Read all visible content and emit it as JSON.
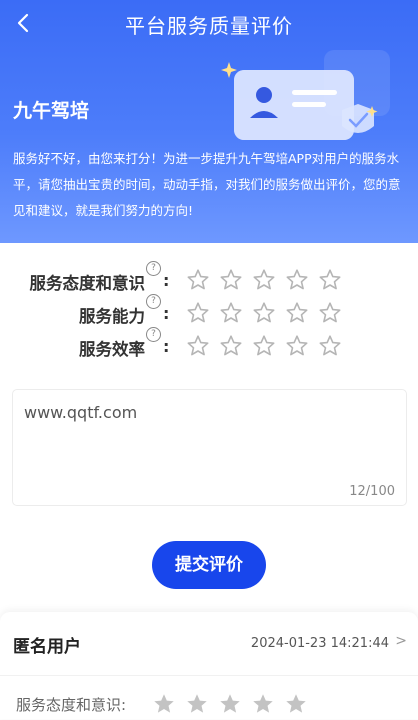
{
  "header": {
    "back_icon": "chevron-left-icon",
    "title": "平台服务质量评价"
  },
  "hero": {
    "brand": "九午驾培",
    "intro": "服务好不好，由您来打分！为进一步提升九午驾培APP对用户的服务水平，请您抽出宝贵的时间，动动手指，对我们的服务做出评价，您的意见和建议，就是我们努力的方向!"
  },
  "rating": {
    "items": [
      {
        "label": "服务态度和意识",
        "help_icon": "question-circle-icon",
        "colon": ":",
        "stars": 0,
        "max": 5
      },
      {
        "label": "服务能力",
        "help_icon": "question-circle-icon",
        "colon": ":",
        "stars": 0,
        "max": 5
      },
      {
        "label": "服务效率",
        "help_icon": "question-circle-icon",
        "colon": ":",
        "stars": 0,
        "max": 5
      }
    ]
  },
  "comment": {
    "value": "www.qqtf.com",
    "counter": "12/100"
  },
  "submit_label": "提交评价",
  "review": {
    "user": "匿名用户",
    "time": "2024-01-23 14:21:44",
    "chevron": ">",
    "item_label": "服务态度和意识:",
    "stars": 5
  },
  "colors": {
    "primary": "#1846ec",
    "hero_start": "#3b6cf6",
    "star_outline": "#b5b5b5",
    "star_filled": "#c3c3c3"
  }
}
